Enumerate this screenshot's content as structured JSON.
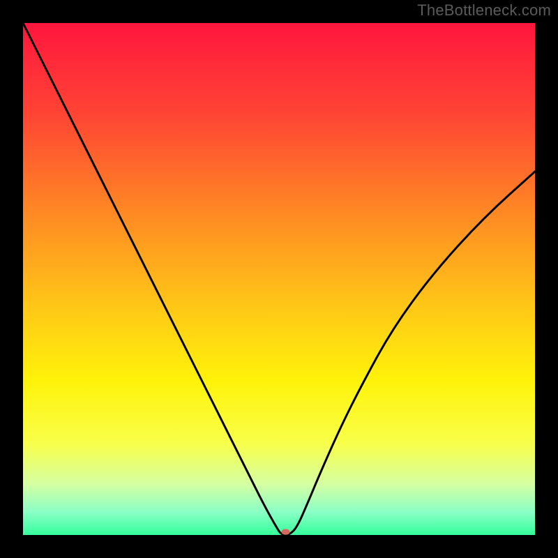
{
  "watermark": "TheBottleneck.com",
  "chart_data": {
    "type": "line",
    "title": "",
    "xlabel": "",
    "ylabel": "",
    "xlim": [
      0,
      100
    ],
    "ylim": [
      0,
      100
    ],
    "grid": false,
    "legend": false,
    "background_gradient_stops": [
      {
        "offset": 0.0,
        "color": "#ff163e"
      },
      {
        "offset": 0.18,
        "color": "#ff4534"
      },
      {
        "offset": 0.38,
        "color": "#ff8c23"
      },
      {
        "offset": 0.55,
        "color": "#ffc617"
      },
      {
        "offset": 0.7,
        "color": "#fff30a"
      },
      {
        "offset": 0.82,
        "color": "#f8ff4a"
      },
      {
        "offset": 0.9,
        "color": "#d6ffa2"
      },
      {
        "offset": 0.955,
        "color": "#8bffc6"
      },
      {
        "offset": 1.0,
        "color": "#34ff9b"
      }
    ],
    "series": [
      {
        "name": "bottleneck-curve",
        "stroke": "#000000",
        "stroke_width": 3,
        "x": [
          0,
          4,
          8,
          12,
          16,
          20,
          24,
          28,
          32,
          36,
          40,
          44,
          47,
          49.5,
          50.5,
          52,
          53.5,
          55.5,
          58,
          62,
          66,
          72,
          80,
          90,
          100
        ],
        "y": [
          100,
          92,
          84,
          76,
          68,
          60,
          52,
          44,
          36,
          28,
          20,
          12,
          6,
          1.5,
          0,
          0,
          1.5,
          6,
          12,
          21,
          29,
          40,
          51,
          62,
          71
        ]
      }
    ],
    "marker": {
      "name": "optimal-point",
      "x": 51.3,
      "y": 0.6,
      "rx": 6,
      "ry": 4.2,
      "fill": "#d46a5f"
    }
  }
}
